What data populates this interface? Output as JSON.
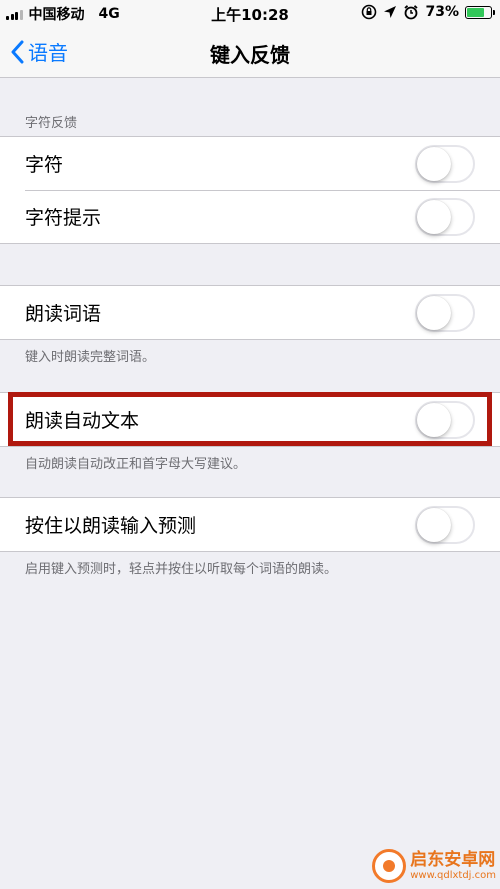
{
  "status_bar": {
    "carrier": "中国移动",
    "network": "4G",
    "time": "上午10:28",
    "battery_percent": "73%",
    "battery_level": 0.73,
    "icons": [
      "rotation-lock-icon",
      "location-icon",
      "alarm-icon",
      "battery-icon"
    ]
  },
  "nav": {
    "back_label": "语音",
    "title": "键入反馈"
  },
  "sections": [
    {
      "header": "字符反馈",
      "rows": [
        {
          "label": "字符",
          "on": false
        },
        {
          "label": "字符提示",
          "on": false
        }
      ]
    },
    {
      "rows": [
        {
          "label": "朗读词语",
          "on": false
        }
      ],
      "footer": "键入时朗读完整词语。"
    },
    {
      "rows": [
        {
          "label": "朗读自动文本",
          "on": false
        }
      ],
      "footer": "自动朗读自动改正和首字母大写建议。"
    },
    {
      "rows": [
        {
          "label": "按住以朗读输入预测",
          "on": false
        }
      ],
      "footer": "启用键入预测时，轻点并按住以听取每个词语的朗读。"
    }
  ],
  "colors": {
    "accent": "#0a7aff",
    "highlight": "#b0180e",
    "battery": "#32c759"
  },
  "watermark": {
    "name": "启东安卓网",
    "url": "www.qdlxtdj.com"
  }
}
